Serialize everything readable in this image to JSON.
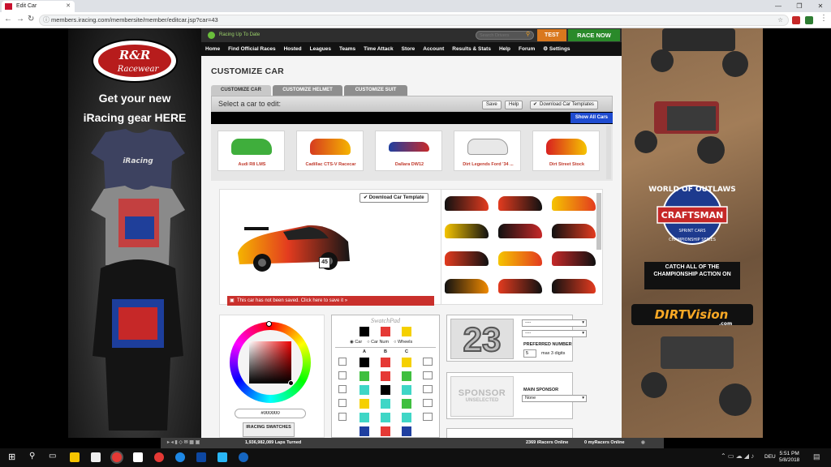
{
  "browser": {
    "tab_title": "Edit Car",
    "url": "members.iracing.com/membersite/member/editcar.jsp?car=43",
    "window_controls": [
      "—",
      "❐",
      "✕"
    ]
  },
  "left_ad": {
    "brand": "R&R Racewear",
    "headline_1": "Get your new",
    "headline_2": "iRacing gear HERE"
  },
  "right_ad": {
    "series_top": "WORLD OF OUTLAWS",
    "series_main": "CRAFTSMAN",
    "series_sub": "SPRINT CARS",
    "series_ring": "CHAMPIONSHIP SERIES",
    "cta": "CATCH ALL OF THE CHAMPIONSHIP ACTION ON",
    "dirtvision": "DIRTVision",
    "dirtvision_sub": ".com"
  },
  "site": {
    "status_text": "Racing Up To Date",
    "search_placeholder": "Search Drivers",
    "test_label": "TEST",
    "race_now_label": "RACE NOW",
    "nav": [
      "Home",
      "Find Official Races",
      "Hosted",
      "Leagues",
      "Teams",
      "Time Attack",
      "Store",
      "Account",
      "Results & Stats",
      "Help",
      "Forum",
      "⚙ Settings"
    ]
  },
  "page": {
    "title": "CUSTOMIZE CAR",
    "tabs": [
      "CUSTOMIZE CAR",
      "CUSTOMIZE HELMET",
      "CUSTOMIZE SUIT"
    ],
    "select_prompt": "Select a car to edit:",
    "save_label": "Save",
    "help_label": "Help",
    "templates_label": "Download Car Templates",
    "show_all_label": "Show All Cars",
    "cars": [
      {
        "name": "Audi R8 LMS",
        "color": "#3fae3c"
      },
      {
        "name": "Cadillac CTS-V Racecar",
        "color": "#d63b1f"
      },
      {
        "name": "Dallara DW12",
        "color": "#c72a2a"
      },
      {
        "name": "Dirt Legends Ford '34 ...",
        "color": "#e8e8e8"
      },
      {
        "name": "Dirt Street Stock",
        "color": "#d82020"
      }
    ],
    "download_template_label": "Download Car Template",
    "unsaved_warning": "This car has not been saved. Click here to save it »",
    "car_number_badge": "45"
  },
  "editor": {
    "hex_value": "#000000",
    "iracing_swatches_label": "IRACING SWATCHES",
    "swatchpad_title": "SwatchPad",
    "targets": [
      "Car",
      "Car Num",
      "Wheels"
    ],
    "columns": [
      "A",
      "B",
      "C"
    ],
    "number_display": "23",
    "font_select": "----",
    "color_select": "----",
    "preferred_number_label": "PREFERRED NUMBER",
    "preferred_number_value": "5",
    "max_digits_label": "max 3 digits",
    "sponsor_label": "SPONSOR",
    "sponsor_sub": "UNSELECTED",
    "main_sponsor_label": "MAIN SPONSOR",
    "main_sponsor_value": "None"
  },
  "footer": {
    "laps_turned": "1,936,982,089 Laps Turned",
    "online": "2369 iRacers Online",
    "my_online": "0 myRacers Online"
  },
  "taskbar": {
    "time": "5:51 PM",
    "date": "5/8/2018",
    "lang": "DEU"
  },
  "colors": {
    "accent_blue": "#1e4bd0",
    "race_now_green": "#2a8a2a",
    "test_orange": "#d9781e",
    "warning_red": "#c9302c"
  }
}
